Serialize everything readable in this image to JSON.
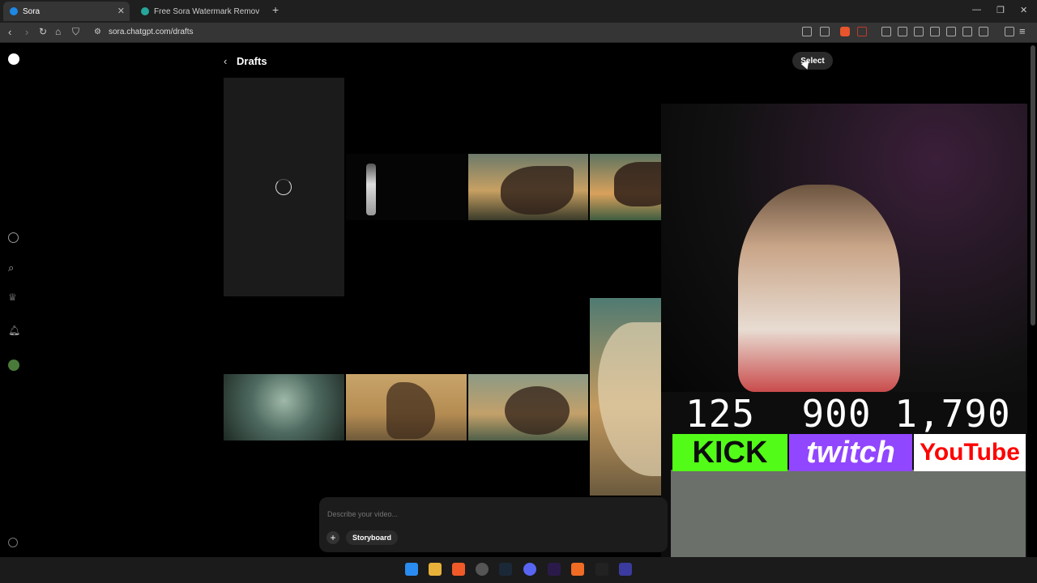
{
  "browser": {
    "tabs": [
      {
        "label": "Sora",
        "active": true
      },
      {
        "label": "Free Sora Watermark Remover – One",
        "active": false
      }
    ],
    "url": "sora.chatgpt.com/drafts"
  },
  "page": {
    "title": "Drafts",
    "select_label": "Select",
    "prompt_placeholder": "Describe your video...",
    "storyboard_label": "Storyboard"
  },
  "stream": {
    "counts": "125  900 1,790",
    "kick": "KICK",
    "twitch": "twitch",
    "youtube": "YouTube"
  },
  "colors": {
    "accent_green": "#53fc18",
    "twitch_purple": "#9146ff",
    "youtube_red": "#ff0000"
  }
}
